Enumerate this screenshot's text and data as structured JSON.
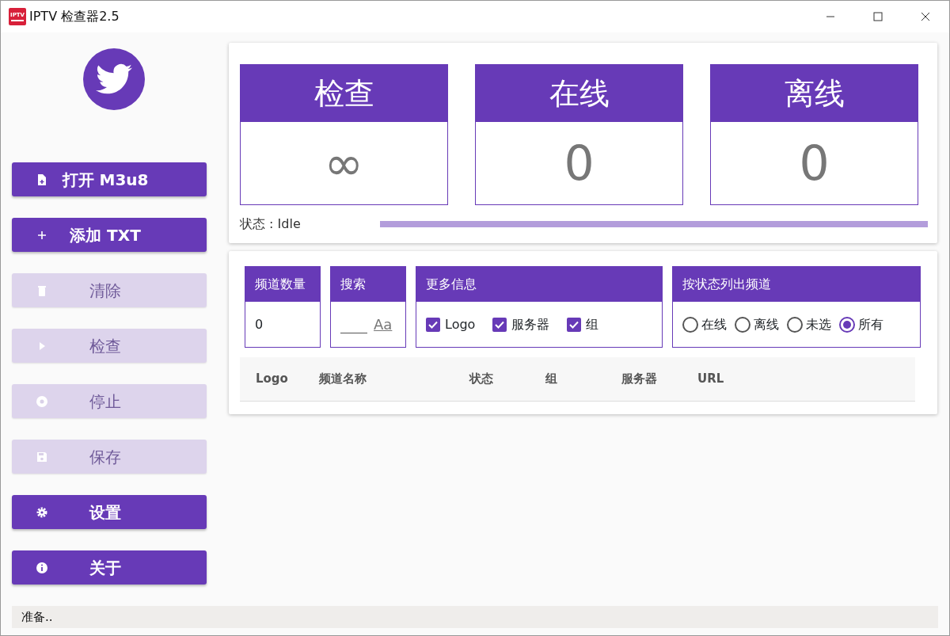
{
  "window": {
    "title": "IPTV 检查器2.5",
    "app_icon_text": "IPTV"
  },
  "sidebar": {
    "buttons": [
      {
        "label": "打开 M3u8",
        "kind": "open",
        "disabled": false
      },
      {
        "label": "添加 TXT",
        "kind": "add",
        "disabled": false
      },
      {
        "label": "清除",
        "kind": "clear",
        "disabled": true
      },
      {
        "label": "检查",
        "kind": "check",
        "disabled": true
      },
      {
        "label": "停止",
        "kind": "stop",
        "disabled": true
      },
      {
        "label": "保存",
        "kind": "save",
        "disabled": true
      },
      {
        "label": "设置",
        "kind": "settings",
        "disabled": false
      },
      {
        "label": "关于",
        "kind": "about",
        "disabled": false
      }
    ]
  },
  "stats": [
    {
      "title": "检查",
      "value": "∞"
    },
    {
      "title": "在线",
      "value": "0"
    },
    {
      "title": "离线",
      "value": "0"
    }
  ],
  "status": {
    "label": "状态 : Idle",
    "level": 0
  },
  "filters": {
    "channel_count": {
      "title": "频道数量",
      "value": "0"
    },
    "search": {
      "title": "搜索",
      "case_toggle": "Aa"
    },
    "more_info": {
      "title": "更多信息",
      "options": [
        {
          "label": "Logo",
          "checked": true
        },
        {
          "label": "服务器",
          "checked": true
        },
        {
          "label": "组",
          "checked": true
        }
      ]
    },
    "by_status": {
      "title": "按状态列出频道",
      "options": [
        {
          "label": "在线",
          "selected": false
        },
        {
          "label": "离线",
          "selected": false
        },
        {
          "label": "未选",
          "selected": false
        },
        {
          "label": "所有",
          "selected": true
        }
      ]
    }
  },
  "table": {
    "columns": [
      "Logo",
      "频道名称",
      "状态",
      "组",
      "服务器",
      "URL"
    ]
  },
  "status_bar": "准备.."
}
